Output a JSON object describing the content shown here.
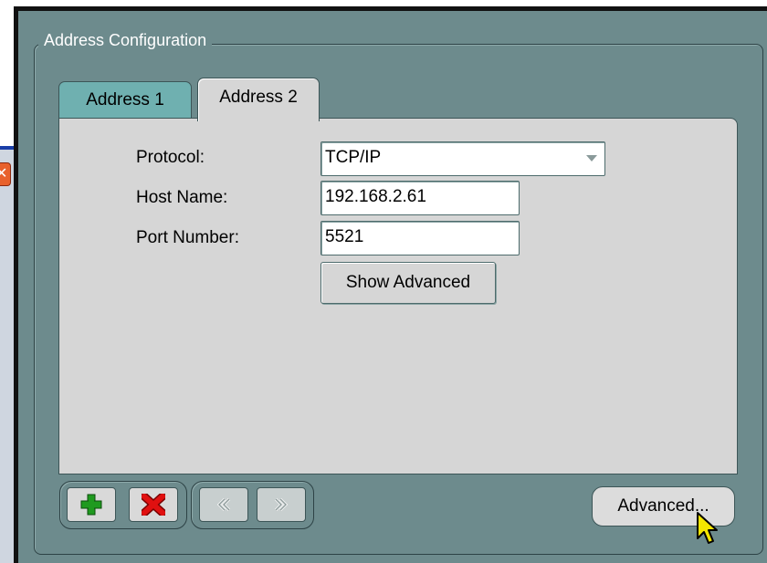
{
  "dialog": {
    "group_title": "Address Configuration",
    "tabs": [
      {
        "label": "Address 1",
        "selected": false
      },
      {
        "label": "Address 2",
        "selected": true
      }
    ],
    "form": {
      "protocol_label": "Protocol:",
      "protocol_value": "TCP/IP",
      "host_label": "Host Name:",
      "host_value": "192.168.2.61",
      "port_label": "Port Number:",
      "port_value": "5521",
      "show_advanced_label": "Show Advanced"
    },
    "toolbar": {
      "add_icon": "plus-icon",
      "remove_icon": "x-icon",
      "prev_icon": "chevron-left-icon",
      "next_icon": "chevron-right-icon",
      "add_color": "#1f9a1f",
      "remove_color": "#e01010"
    },
    "advanced_label": "Advanced..."
  },
  "background_window": {
    "close_glyph": "✕",
    "close_color": "#e8612c"
  }
}
